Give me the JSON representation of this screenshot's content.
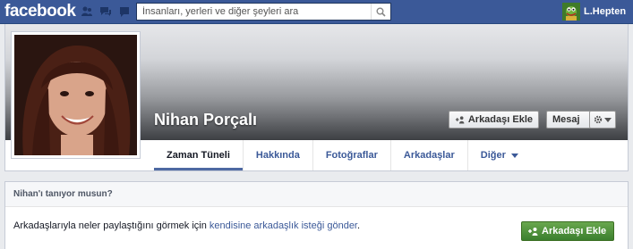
{
  "topbar": {
    "logo": "facebook",
    "search": {
      "placeholder": "İnsanları, yerleri ve diğer şeyleri ara"
    },
    "user_name": "L.Hepten",
    "jewels": [
      "friend-requests-icon",
      "messages-icon",
      "notifications-icon"
    ]
  },
  "profile": {
    "name": "Nihan Porçalı",
    "add_friend_label": "Arkadaşı Ekle",
    "message_label": "Mesaj",
    "tabs": [
      {
        "label": "Zaman Tüneli",
        "active": true
      },
      {
        "label": "Hakkında"
      },
      {
        "label": "Fotoğraflar"
      },
      {
        "label": "Arkadaşlar"
      },
      {
        "label": "Diğer"
      }
    ]
  },
  "panel": {
    "title": "Nihan'ı tanıyor musun?",
    "body_prefix": "Arkadaşlarıyla neler paylaştığını görmek için ",
    "body_link": "kendisine arkadaşlık isteği gönder",
    "body_suffix": ".",
    "add_friend_label": "Arkadaşı Ekle"
  },
  "colors": {
    "brand_blue": "#3b5998",
    "link_blue": "#3b5998",
    "green_button": "#4c8c3a"
  }
}
